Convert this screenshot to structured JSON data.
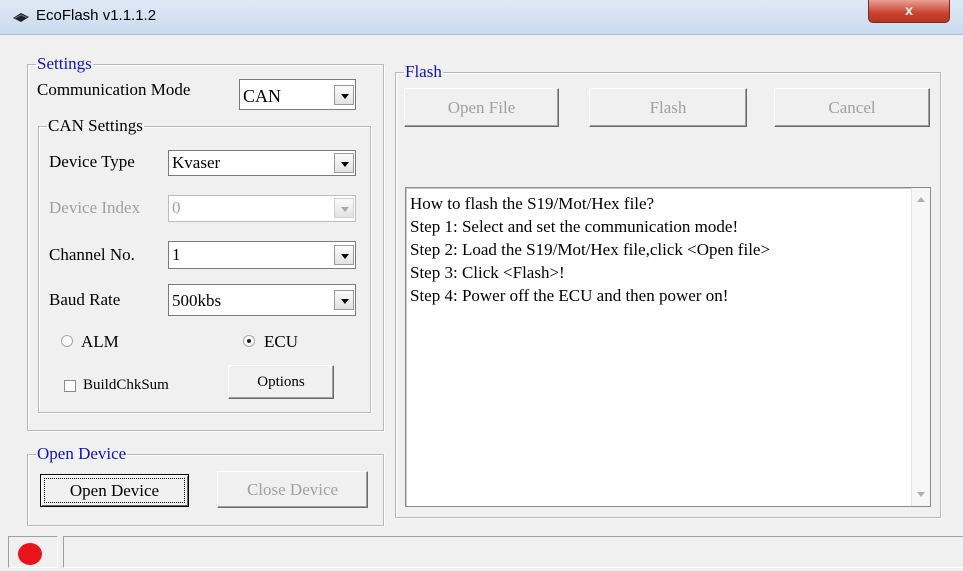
{
  "window": {
    "title": "EcoFlash v1.1.1.2",
    "close_label": "x",
    "app_icon": "chip-icon"
  },
  "settings": {
    "legend": "Settings",
    "comm_mode_label": "Communication Mode",
    "comm_mode_value": "CAN",
    "can": {
      "legend": "CAN Settings",
      "device_type_label": "Device Type",
      "device_type_value": "Kvaser",
      "device_index_label": "Device Index",
      "device_index_value": "0",
      "channel_label": "Channel No.",
      "channel_value": "1",
      "baud_label": "Baud Rate",
      "baud_value": "500kbs",
      "radio_alm_label": "ALM",
      "radio_ecu_label": "ECU",
      "selected_mode": "ECU",
      "buildchk_label": "BuildChkSum",
      "buildchk_checked": false,
      "options_label": "Options"
    }
  },
  "open_device": {
    "legend": "Open Device",
    "open_label": "Open Device",
    "close_label": "Close Device"
  },
  "flash": {
    "legend": "Flash",
    "open_file_label": "Open File",
    "flash_label": "Flash",
    "cancel_label": "Cancel",
    "log_lines": [
      "How to flash the S19/Mot/Hex file?",
      "Step 1: Select and set the communication mode!",
      "Step 2: Load the S19/Mot/Hex file,click <Open file>",
      "Step 3: Click <Flash>!",
      "Step 4: Power off the ECU and then power on!"
    ]
  },
  "status": {
    "indicator_color": "#e8141a",
    "text": ""
  },
  "colors": {
    "legend_blue": "#1010c8",
    "disabled_text": "#a0a0a0"
  }
}
